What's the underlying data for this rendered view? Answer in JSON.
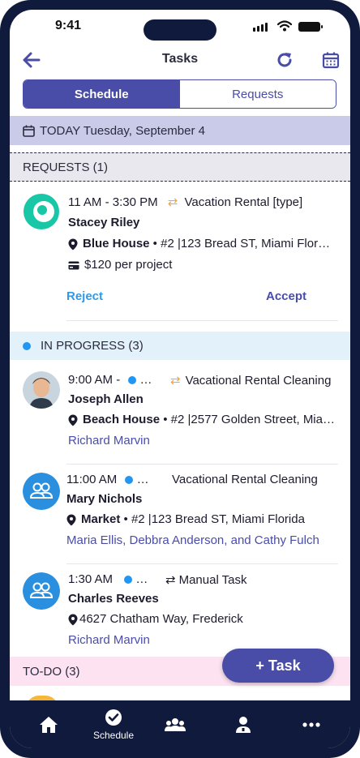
{
  "status_bar": {
    "time": "9:41"
  },
  "header": {
    "title": "Tasks"
  },
  "segments": {
    "schedule": "Schedule",
    "requests": "Requests"
  },
  "today": "TODAY Tuesday, September 4",
  "requests_section": {
    "heading": "REQUESTS (1)",
    "item": {
      "time": "11 AM - 3:30 PM",
      "type": "Vacation Rental [type]",
      "name": "Stacey Riley",
      "place": "Blue House",
      "address": "#2 |123  Bread ST, Miami Flor…",
      "price": "$120 per project",
      "reject": "Reject",
      "accept": "Accept"
    }
  },
  "in_progress": {
    "heading": "IN PROGRESS (3)",
    "items": [
      {
        "time": "9:00 AM -",
        "ellipsis": "…",
        "type": "Vacational Rental Cleaning",
        "name": "Joseph Allen",
        "place": "Beach House",
        "address": "#2 |2577 Golden Street, Mia…",
        "assignees": "Richard Marvin"
      },
      {
        "time": "11:00 AM",
        "ellipsis": "…",
        "type": "Vacational Rental Cleaning",
        "name": "Mary Nichols",
        "place": "Market",
        "address": "#2 |123  Bread ST, Miami Florida",
        "assignees": "Maria Ellis, Debbra Anderson, and Cathy Fulch"
      },
      {
        "time": "1:30 AM",
        "ellipsis": "…",
        "type": "Manual Task",
        "name": "Charles Reeves",
        "place": "",
        "address": "4627  Chatham Way, Frederick",
        "assignees": "Richard Marvin"
      }
    ]
  },
  "todo": {
    "heading": "TO-DO (3)"
  },
  "fab": {
    "label": "+ Task"
  },
  "tabbar": {
    "schedule": "Schedule"
  },
  "colors": {
    "primary": "#4a4da8",
    "navy": "#0f1a3c",
    "progress_dot": "#2196f3",
    "swap": "#f5a23c",
    "todo_band": "#fde3f2"
  },
  "icons": [
    "back-arrow-icon",
    "refresh-icon",
    "calendar-icon",
    "swap-icon",
    "location-pin-icon",
    "credit-card-icon",
    "group-icon",
    "home-icon",
    "check-circle-icon",
    "people-icon",
    "person-icon",
    "more-icon"
  ]
}
